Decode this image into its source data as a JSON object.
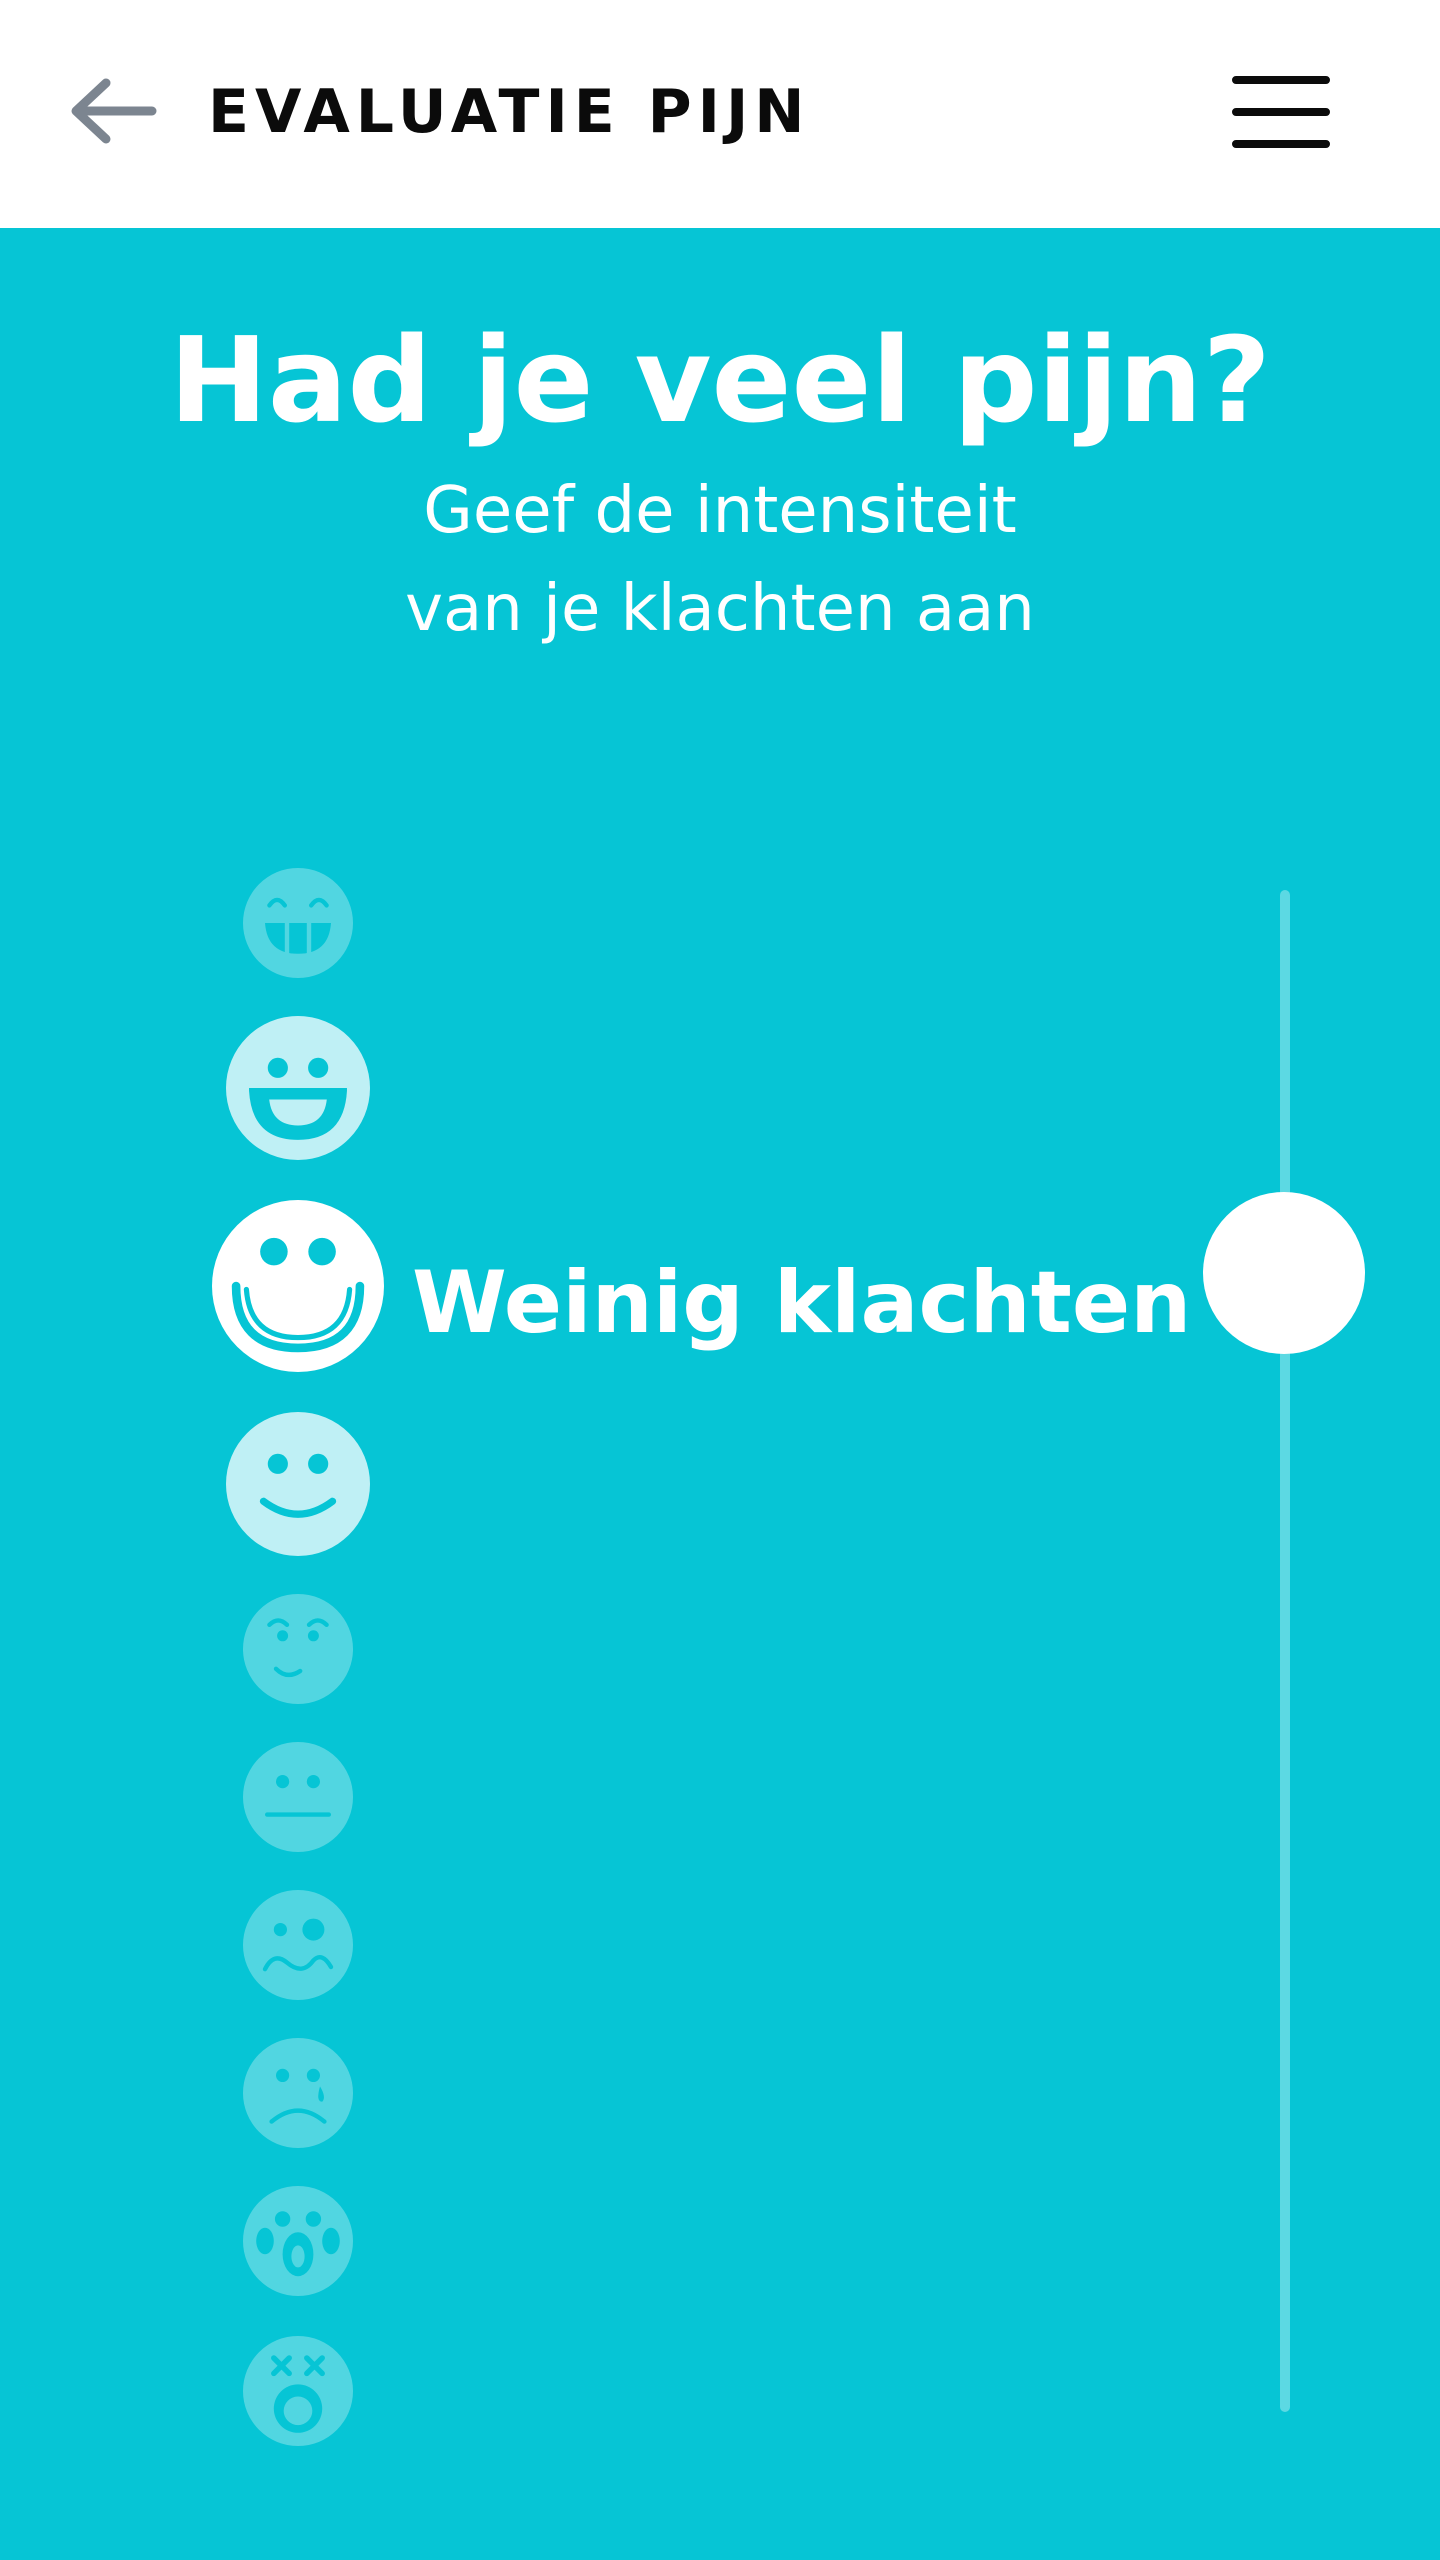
{
  "header": {
    "title": "EVALUATIE PIJN",
    "back_icon": "arrow-left-icon",
    "menu_icon": "hamburger-menu-icon"
  },
  "main": {
    "question": "Had je veel pijn?",
    "subtitle_line1": "Geef de intensiteit",
    "subtitle_line2": "van je klachten aan"
  },
  "scale": {
    "selected_label": "Weinig klachten",
    "selected_index": 2,
    "levels_count": 10,
    "face_icons": [
      "grinning-teeth-face-icon",
      "big-smile-face-icon",
      "smiling-face-icon",
      "slight-smile-face-icon",
      "uneasy-face-icon",
      "neutral-face-icon",
      "confused-face-icon",
      "sad-tear-face-icon",
      "crying-face-icon",
      "dizzy-face-icon"
    ]
  },
  "slider": {
    "value_fraction": 0.2
  },
  "colors": {
    "background": "#06c5d5",
    "header": "#ffffff",
    "text_on_accent": "#ffffff",
    "face_light": "#bff0f5"
  }
}
